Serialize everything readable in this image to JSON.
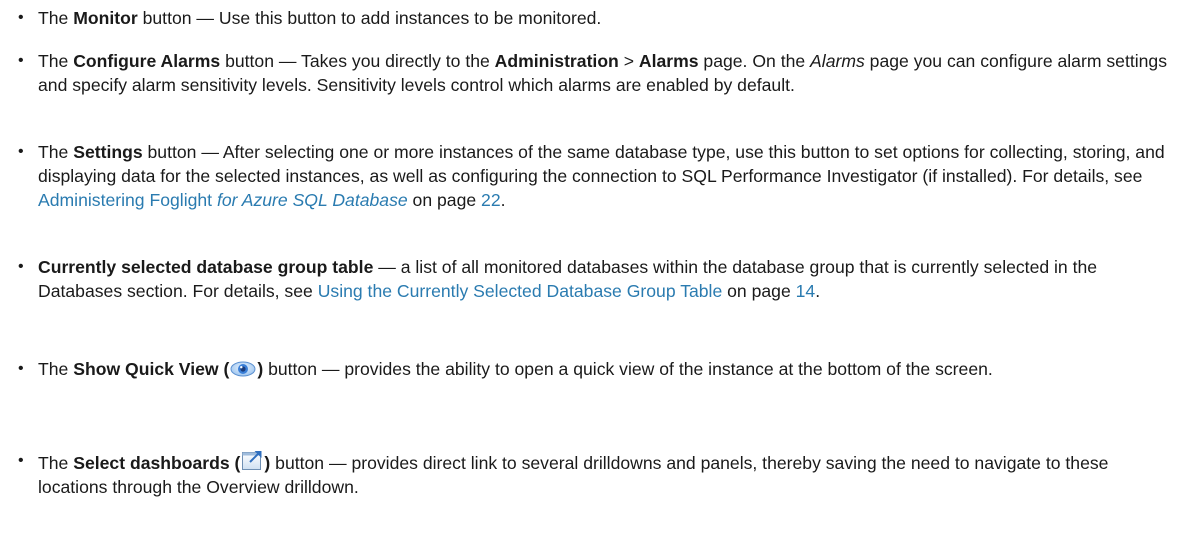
{
  "items": [
    {
      "pre": "The ",
      "bold": "Monitor",
      "post": " button — Use this button to add instances to be monitored."
    },
    {
      "pre": "The ",
      "bold": "Configure Alarms",
      "mid1": " button — Takes you directly to the ",
      "bold2": "Administration",
      "sep": " > ",
      "bold3": "Alarms",
      "mid2": " page. On the ",
      "italic": "Alarms",
      "post": " page you can configure alarm settings and specify alarm sensitivity levels. Sensitivity levels control which alarms are enabled by default."
    },
    {
      "pre": "The ",
      "bold": "Settings",
      "mid": " button — After selecting one or more instances of the same database type, use this button to set options for collecting, storing, and displaying data for the selected instances, as well as configuring the connection to SQL Performance Investigator (if installed). For details, see ",
      "link_a": "Administering Foglight ",
      "link_b": "for Azure SQL Database",
      "on_page": " on page ",
      "page_num": "22",
      "post": "."
    },
    {
      "bold": "Currently selected database group table",
      "mid": " — a list of all monitored databases within the database group that is currently selected in the Databases section. For details, see ",
      "link": "Using the Currently Selected Database Group Table",
      "on_page": " on page ",
      "page_num": "14",
      "post": "."
    },
    {
      "pre": "The ",
      "bold": "Show Quick View (",
      "icon": "eye-icon",
      "bold_close": ")",
      "post": " button — provides the ability to open a quick view of the instance at the bottom of the screen."
    },
    {
      "pre": "The ",
      "bold": "Select dashboards (",
      "icon": "select-dashboards-icon",
      "bold_close": ")",
      "post": " button — provides direct link to several drilldowns and panels, thereby saving the need to navigate to these locations through the Overview drilldown."
    }
  ],
  "colors": {
    "text": "#1a1a1a",
    "link": "#2a7bb0"
  }
}
